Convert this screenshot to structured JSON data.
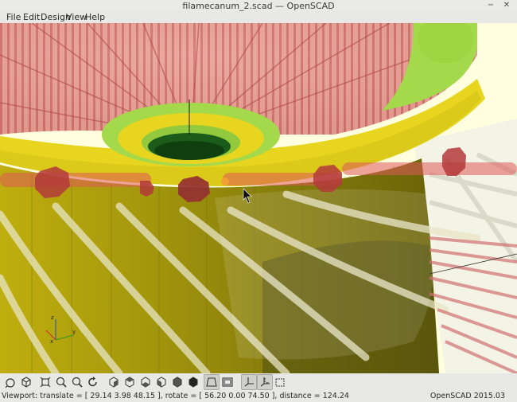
{
  "window": {
    "title": "filamecanum_2.scad — OpenSCAD",
    "minimize_glyph": "−",
    "close_glyph": "✕"
  },
  "menu": [
    "File",
    "Edit",
    "Design",
    "View",
    "Help"
  ],
  "axes": {
    "x": "x",
    "y": "y",
    "z": "z"
  },
  "colors": {
    "yellow": "#e8d51f",
    "green": "#a3d94a",
    "red_transparent": "#e05a5a"
  },
  "toolbar": {
    "buttons": [
      {
        "name": "preview-icon"
      },
      {
        "name": "render-icon"
      },
      {
        "name": "view-all-icon"
      },
      {
        "name": "zoom-in-icon"
      },
      {
        "name": "zoom-out-icon"
      },
      {
        "name": "reset-view-icon"
      },
      {
        "name": "view-right-icon"
      },
      {
        "name": "view-top-icon"
      },
      {
        "name": "view-bottom-icon"
      },
      {
        "name": "view-left-icon"
      },
      {
        "name": "view-front-icon"
      },
      {
        "name": "view-back-icon"
      },
      {
        "name": "perspective-icon"
      },
      {
        "name": "orthogonal-icon"
      },
      {
        "name": "show-axes-icon"
      },
      {
        "name": "show-scale-icon"
      },
      {
        "name": "show-edges-icon"
      }
    ]
  },
  "status": {
    "viewport": "Viewport: translate = [ 29.14 3.98 48.15 ], rotate = [ 56.20 0.00 74.50 ], distance = 124.24",
    "version": "OpenSCAD 2015.03"
  }
}
